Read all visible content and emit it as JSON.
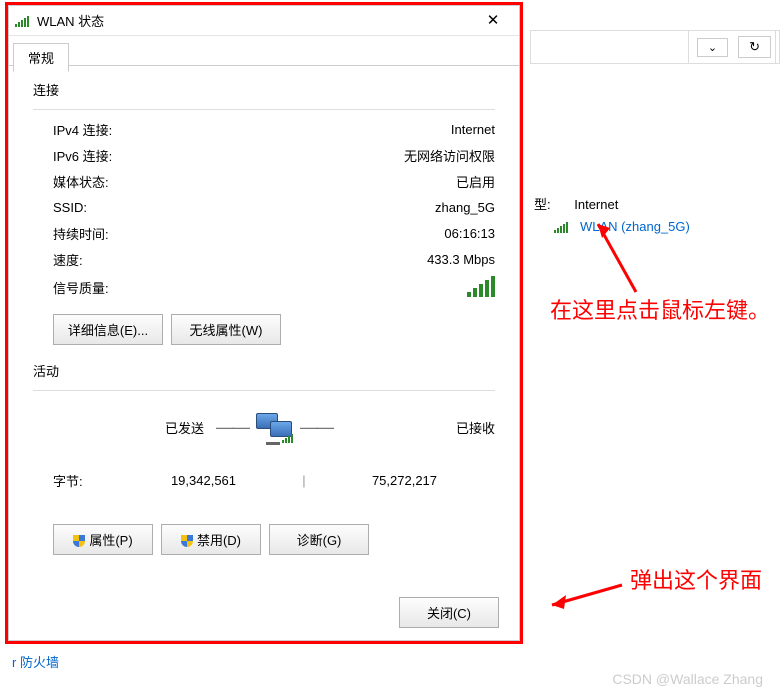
{
  "dialog": {
    "title": "WLAN 状态",
    "tab": "常规",
    "connection": {
      "heading": "连接",
      "rows": {
        "ipv4_k": "IPv4 连接:",
        "ipv4_v": "Internet",
        "ipv6_k": "IPv6 连接:",
        "ipv6_v": "无网络访问权限",
        "media_k": "媒体状态:",
        "media_v": "已启用",
        "ssid_k": "SSID:",
        "ssid_v": "zhang_5G",
        "duration_k": "持续时间:",
        "duration_v": "06:16:13",
        "speed_k": "速度:",
        "speed_v": "433.3 Mbps",
        "signal_k": "信号质量:"
      },
      "btn_details": "详细信息(E)...",
      "btn_wireless": "无线属性(W)"
    },
    "activity": {
      "heading": "活动",
      "sent": "已发送",
      "received": "已接收",
      "bytes_k": "字节:",
      "bytes_sent": "19,342,561",
      "bytes_recv": "75,272,217"
    },
    "buttons": {
      "properties": "属性(P)",
      "disable": "禁用(D)",
      "diagnose": "诊断(G)",
      "close": "关闭(C)"
    }
  },
  "right": {
    "type_label": "型:",
    "type_value": "Internet",
    "link": "WLAN (zhang_5G)"
  },
  "callout1": "在这里点击鼠标左键。",
  "callout2": "弹出这个界面",
  "bottom": "r 防火墙",
  "watermark": "CSDN @Wallace Zhang",
  "toolbar": {
    "dropdown": "⌄",
    "refresh": "↻"
  }
}
